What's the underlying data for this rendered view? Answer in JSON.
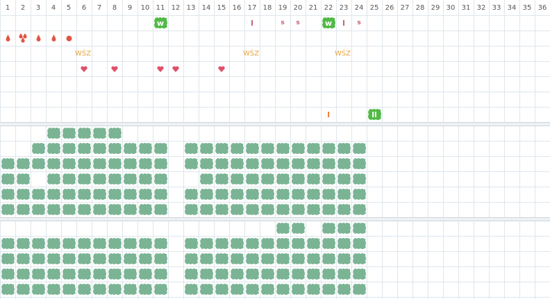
{
  "colors": {
    "grid": "#dde6ec",
    "header_grid": "#dfe4e8",
    "cell_fill": "#7bb494",
    "accent_green": "#52b947",
    "label_orange": "#e8a53a",
    "heart_red": "#e0506a",
    "drop_red": "#e05545",
    "tick_red": "#c65b72",
    "tick_orange": "#f07a3a"
  },
  "columns": [
    "1",
    "2",
    "3",
    "4",
    "5",
    "6",
    "7",
    "8",
    "9",
    "10",
    "11",
    "12",
    "13",
    "14",
    "15",
    "16",
    "17",
    "18",
    "19",
    "20",
    "21",
    "22",
    "23",
    "24",
    "25",
    "26",
    "27",
    "28",
    "29",
    "30",
    "31",
    "32",
    "33",
    "34",
    "35",
    "36"
  ],
  "annotations": {
    "row1": [
      {
        "col": 11,
        "label": "w",
        "kind": "badge"
      },
      {
        "col": 17,
        "label": "l",
        "kind": "tick"
      },
      {
        "col": 19,
        "label": "s",
        "kind": "tick"
      },
      {
        "col": 20,
        "label": "s",
        "kind": "tick"
      },
      {
        "col": 22,
        "label": "w",
        "kind": "badge"
      },
      {
        "col": 23,
        "label": "l",
        "kind": "tick"
      },
      {
        "col": 24,
        "label": "s",
        "kind": "tick"
      }
    ],
    "row2": [
      {
        "col": 1,
        "icon": "drop-icon"
      },
      {
        "col": 2,
        "icon": "double-drop-icon"
      },
      {
        "col": 3,
        "icon": "drop-icon"
      },
      {
        "col": 4,
        "icon": "drop-icon"
      },
      {
        "col": 5,
        "icon": "circle-icon"
      }
    ],
    "row3": [
      {
        "col": 6,
        "label": "WŚZ"
      },
      {
        "col": 17,
        "label": "WŚZ"
      },
      {
        "col": 23,
        "label": "WŚZ"
      }
    ],
    "row4": [
      {
        "col": 6,
        "icon": "heart-icon"
      },
      {
        "col": 8,
        "icon": "heart-icon"
      },
      {
        "col": 11,
        "icon": "heart-icon"
      },
      {
        "col": 12,
        "icon": "heart-icon"
      },
      {
        "col": 15,
        "icon": "heart-icon"
      }
    ],
    "row7": [
      {
        "col": 22,
        "label": "l",
        "kind": "tick-orange"
      },
      {
        "col": 25,
        "label": "ll",
        "kind": "badge"
      }
    ]
  },
  "blocks": {
    "block1": [
      [
        4,
        5,
        6,
        7,
        8
      ],
      [
        3,
        4,
        5,
        6,
        7,
        8,
        9,
        10,
        11,
        13,
        14,
        15,
        16,
        17,
        18,
        19,
        20,
        21,
        22,
        23,
        24
      ],
      [
        1,
        2,
        3,
        4,
        5,
        6,
        7,
        8,
        9,
        10,
        11,
        13,
        14,
        15,
        16,
        17,
        18,
        19,
        20,
        21,
        22,
        23,
        24
      ],
      [
        1,
        2,
        4,
        5,
        6,
        7,
        8,
        9,
        10,
        11,
        14,
        15,
        16,
        17,
        18,
        19,
        20,
        21,
        22,
        23,
        24
      ],
      [
        1,
        2,
        3,
        4,
        5,
        6,
        7,
        8,
        9,
        10,
        11,
        13,
        14,
        15,
        16,
        17,
        18,
        19,
        20,
        21,
        22,
        23,
        24
      ],
      [
        1,
        2,
        3,
        4,
        5,
        6,
        7,
        8,
        9,
        10,
        11,
        13,
        14,
        15,
        16,
        17,
        18,
        19,
        20,
        21,
        22,
        23,
        24
      ]
    ],
    "block2": [
      [
        19,
        20,
        22,
        23,
        24
      ],
      [
        1,
        2,
        3,
        4,
        5,
        6,
        7,
        8,
        9,
        10,
        11,
        13,
        14,
        15,
        16,
        17,
        18,
        19,
        20,
        21,
        22,
        23,
        24
      ],
      [
        1,
        2,
        3,
        4,
        5,
        6,
        7,
        8,
        9,
        10,
        11,
        13,
        14,
        15,
        16,
        17,
        18,
        19,
        20,
        21,
        22,
        23,
        24
      ],
      [
        1,
        2,
        3,
        4,
        5,
        6,
        7,
        8,
        9,
        10,
        11,
        13,
        14,
        15,
        16,
        17,
        18,
        19,
        20,
        21,
        22,
        23,
        24
      ],
      [
        1,
        2,
        3,
        4,
        5,
        6,
        7,
        8,
        9,
        10,
        11,
        13,
        14,
        15,
        16,
        17,
        18,
        19,
        20,
        21,
        22,
        23,
        24
      ]
    ]
  }
}
